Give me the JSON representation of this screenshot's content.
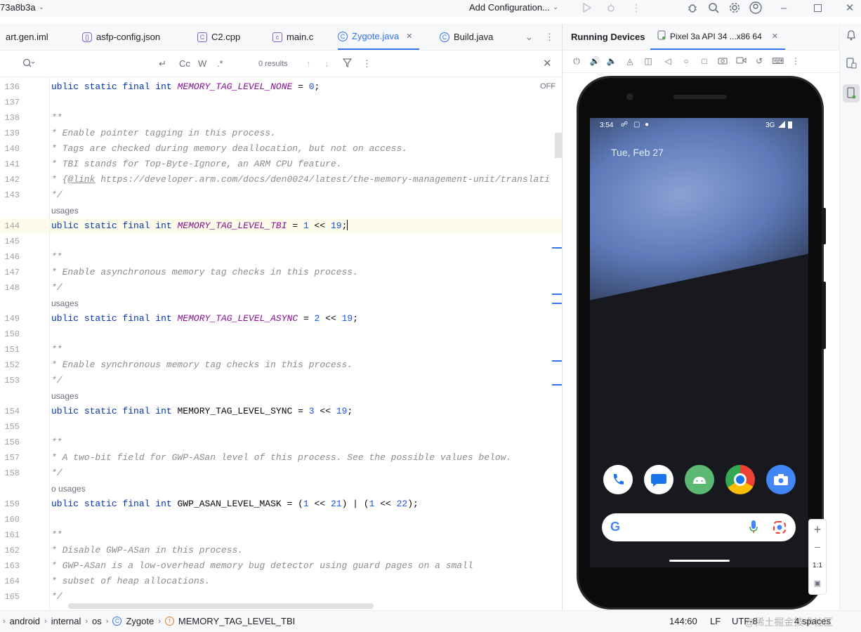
{
  "titlebar": {
    "project_hash": "73a8b3a",
    "run_config": "Add Configuration..."
  },
  "tabs": [
    {
      "label": "art.gen.iml",
      "icon": "iml-icon"
    },
    {
      "label": "asfp-config.json",
      "icon": "json-icon"
    },
    {
      "label": "C2.cpp",
      "icon": "cpp-icon"
    },
    {
      "label": "main.c",
      "icon": "c-icon"
    },
    {
      "label": "Zygote.java",
      "icon": "java-class-icon",
      "active": true
    },
    {
      "label": "Build.java",
      "icon": "java-class-icon"
    }
  ],
  "search": {
    "results": "0 results",
    "match_case": "Cc",
    "words": "W",
    "regex": ".*"
  },
  "editor": {
    "off_label": "OFF",
    "lines": [
      {
        "n": "136",
        "code": "ublic static final int MEMORY_TAG_LEVEL_NONE = 0;"
      },
      {
        "n": "137",
        "code": ""
      },
      {
        "n": "138",
        "code": "**"
      },
      {
        "n": "139",
        "code": "* Enable pointer tagging in this process."
      },
      {
        "n": "140",
        "code": "* Tags are checked during memory deallocation, but not on access."
      },
      {
        "n": "141",
        "code": "* TBI stands for Top-Byte-Ignore, an ARM CPU feature."
      },
      {
        "n": "142",
        "code": "* {@link https://developer.arm.com/docs/den0024/latest/the-memory-management-unit/translati"
      },
      {
        "n": "143",
        "code": "*/"
      },
      {
        "n": "",
        "usages": "usages"
      },
      {
        "n": "144",
        "code": "ublic static final int MEMORY_TAG_LEVEL_TBI = 1 << 19;"
      },
      {
        "n": "145",
        "code": ""
      },
      {
        "n": "146",
        "code": "**"
      },
      {
        "n": "147",
        "code": "* Enable asynchronous memory tag checks in this process."
      },
      {
        "n": "148",
        "code": "*/"
      },
      {
        "n": "",
        "usages": "usages"
      },
      {
        "n": "149",
        "code": "ublic static final int MEMORY_TAG_LEVEL_ASYNC = 2 << 19;"
      },
      {
        "n": "150",
        "code": ""
      },
      {
        "n": "151",
        "code": "**"
      },
      {
        "n": "152",
        "code": "* Enable synchronous memory tag checks in this process."
      },
      {
        "n": "153",
        "code": "*/"
      },
      {
        "n": "",
        "usages": "usages"
      },
      {
        "n": "154",
        "code": "ublic static final int MEMORY_TAG_LEVEL_SYNC = 3 << 19;"
      },
      {
        "n": "155",
        "code": ""
      },
      {
        "n": "156",
        "code": "**"
      },
      {
        "n": "157",
        "code": "* A two-bit field for GWP-ASan level of this process. See the possible values below."
      },
      {
        "n": "158",
        "code": "*/"
      },
      {
        "n": "",
        "usages": "o usages"
      },
      {
        "n": "159",
        "code": "ublic static final int GWP_ASAN_LEVEL_MASK = (1 << 21) | (1 << 22);"
      },
      {
        "n": "160",
        "code": ""
      },
      {
        "n": "161",
        "code": "**"
      },
      {
        "n": "162",
        "code": "* Disable GWP-ASan in this process."
      },
      {
        "n": "163",
        "code": "* GWP-ASan is a low-overhead memory bug detector using guard pages on a small"
      },
      {
        "n": "164",
        "code": "* subset of heap allocations."
      },
      {
        "n": "165",
        "code": "*/"
      }
    ]
  },
  "running_devices": {
    "title": "Running Devices",
    "device_tab": "Pixel 3a API 34 ...x86 64",
    "phone": {
      "time": "3:54",
      "network": "3G",
      "date": "Tue, Feb 27"
    },
    "zoom_one_to_one": "1:1"
  },
  "statusbar": {
    "breadcrumbs": [
      "android",
      "internal",
      "os",
      "Zygote",
      "MEMORY_TAG_LEVEL_TBI"
    ],
    "position": "144:60",
    "line_sep": "LF",
    "encoding": "UTF-8",
    "indent": "4 spaces",
    "watermark": "@稀土掘金技术社区"
  },
  "colors": {
    "accent": "#3574f0",
    "keyword": "#0033b3",
    "constant": "#871094",
    "number": "#1750eb",
    "comment": "#8c8c8c"
  }
}
